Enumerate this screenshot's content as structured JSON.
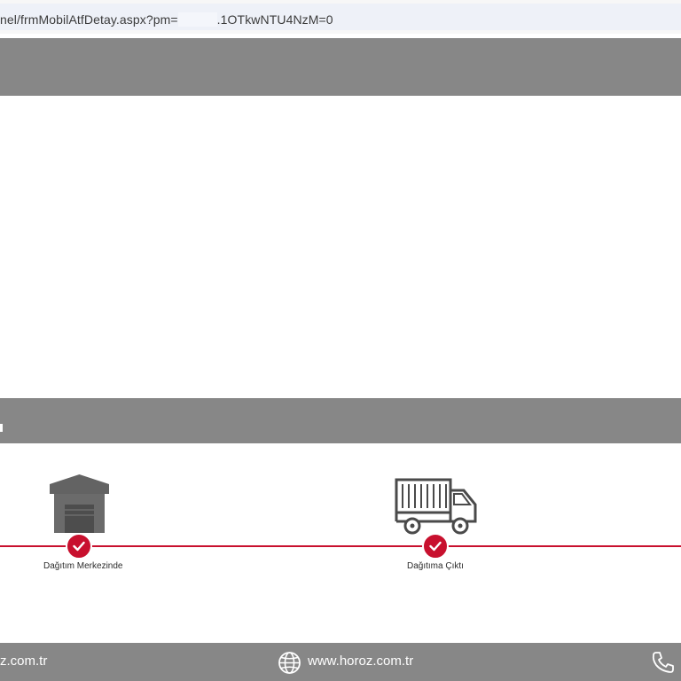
{
  "address_bar": {
    "url_prefix": "nel/frmMobilAtfDetay.aspx?pm=",
    "url_suffix": ".1OTkwNTU4NzM=0"
  },
  "timeline": {
    "accent_color": "#c8102e",
    "steps": [
      {
        "label": "Dağıtım Merkezinde",
        "icon": "warehouse-icon",
        "completed": true
      },
      {
        "label": "Dağıtıma Çıktı",
        "icon": "delivery-truck-icon",
        "completed": true
      }
    ]
  },
  "footer": {
    "left_text": "z.com.tr",
    "website": "www.horoz.com.tr",
    "globe_icon": "globe-icon",
    "phone_icon": "phone-icon"
  }
}
